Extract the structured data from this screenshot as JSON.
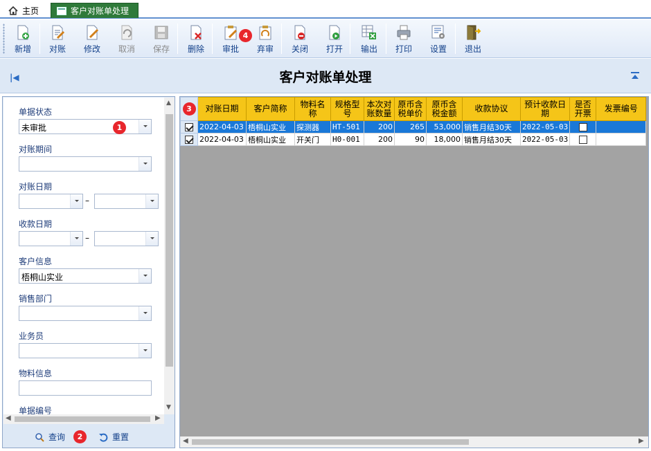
{
  "tabs": {
    "home": "主页",
    "active": "客户对账单处理"
  },
  "toolbar": [
    {
      "label": "新增",
      "icon": "new-doc-icon",
      "disabled": false
    },
    {
      "label": "对账",
      "icon": "reconcile-icon",
      "disabled": false
    },
    {
      "label": "修改",
      "icon": "edit-icon",
      "disabled": false
    },
    {
      "label": "取消",
      "icon": "undo-icon",
      "disabled": true
    },
    {
      "label": "保存",
      "icon": "save-icon",
      "disabled": true
    },
    {
      "label": "删除",
      "icon": "delete-icon",
      "disabled": false
    },
    {
      "label": "审批",
      "icon": "approve-icon",
      "disabled": false
    },
    {
      "label": "弃审",
      "icon": "unapprove-icon",
      "disabled": false
    },
    {
      "label": "关闭",
      "icon": "close-doc-icon",
      "disabled": false
    },
    {
      "label": "打开",
      "icon": "open-doc-icon",
      "disabled": false
    },
    {
      "label": "输出",
      "icon": "export-excel-icon",
      "disabled": false
    },
    {
      "label": "打印",
      "icon": "printer-icon",
      "disabled": false
    },
    {
      "label": "设置",
      "icon": "settings-icon",
      "disabled": false
    },
    {
      "label": "退出",
      "icon": "exit-door-icon",
      "disabled": false
    }
  ],
  "page_title": "客户对账单处理",
  "filters": {
    "status_label": "单据状态",
    "status_value": "未审批",
    "period_label": "对账期间",
    "period_value": "",
    "recon_date_label": "对账日期",
    "receipt_date_label": "收款日期",
    "customer_label": "客户信息",
    "customer_value": "梧桐山实业",
    "dept_label": "销售部门",
    "dept_value": "",
    "salesman_label": "业务员",
    "salesman_value": "",
    "material_label": "物料信息",
    "material_value": "",
    "docno_label": "单据编号",
    "range_dash": "–"
  },
  "actions": {
    "query": "查询",
    "reset": "重置"
  },
  "badges": {
    "b1": "1",
    "b2": "2",
    "b3": "3",
    "b4": "4"
  },
  "grid": {
    "headers": [
      "对账日期",
      "客户简称",
      "物料名称",
      "规格型号",
      "本次对账数量",
      "原币含税单价",
      "原币含税金额",
      "收款协议",
      "预计收款日期",
      "是否开票",
      "发票编号"
    ],
    "rows": [
      {
        "selected": true,
        "checked": true,
        "date": "2022-04-03",
        "customer": "梧桐山实业",
        "material": "探测器",
        "spec": "HT-501",
        "qty": "200",
        "price": "265",
        "amount": "53,000",
        "terms": "销售月结30天",
        "due": "2022-05-03",
        "invoiced": false,
        "invoice_no": ""
      },
      {
        "selected": false,
        "checked": true,
        "date": "2022-04-03",
        "customer": "梧桐山实业",
        "material": "开关门",
        "spec": "H0-001",
        "qty": "200",
        "price": "90",
        "amount": "18,000",
        "terms": "销售月结30天",
        "due": "2022-05-03",
        "invoiced": false,
        "invoice_no": ""
      }
    ]
  }
}
